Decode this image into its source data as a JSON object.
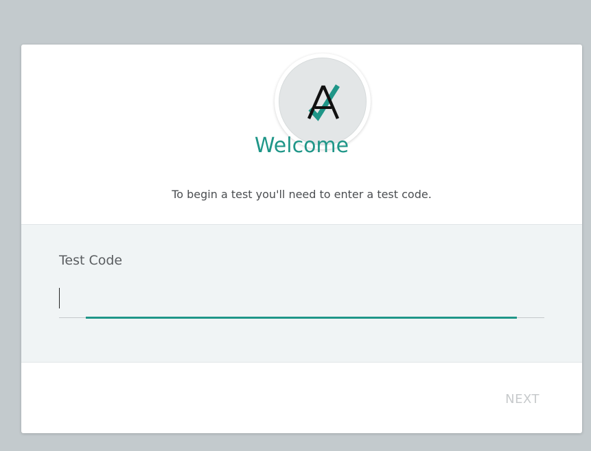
{
  "welcome": {
    "title": "Welcome",
    "subtitle": "To begin a test you'll need to enter a test code."
  },
  "form": {
    "test_code_label": "Test Code",
    "test_code_value": ""
  },
  "actions": {
    "next_label": "NEXT"
  },
  "logo": {
    "icon": "a-check-logo-icon",
    "letter_color": "#111111",
    "check_color": "#1f9688"
  },
  "colors": {
    "accent": "#1f9688",
    "background": "#c3cacd",
    "form_background": "#f0f4f5",
    "disabled_text": "#c7cacc"
  }
}
